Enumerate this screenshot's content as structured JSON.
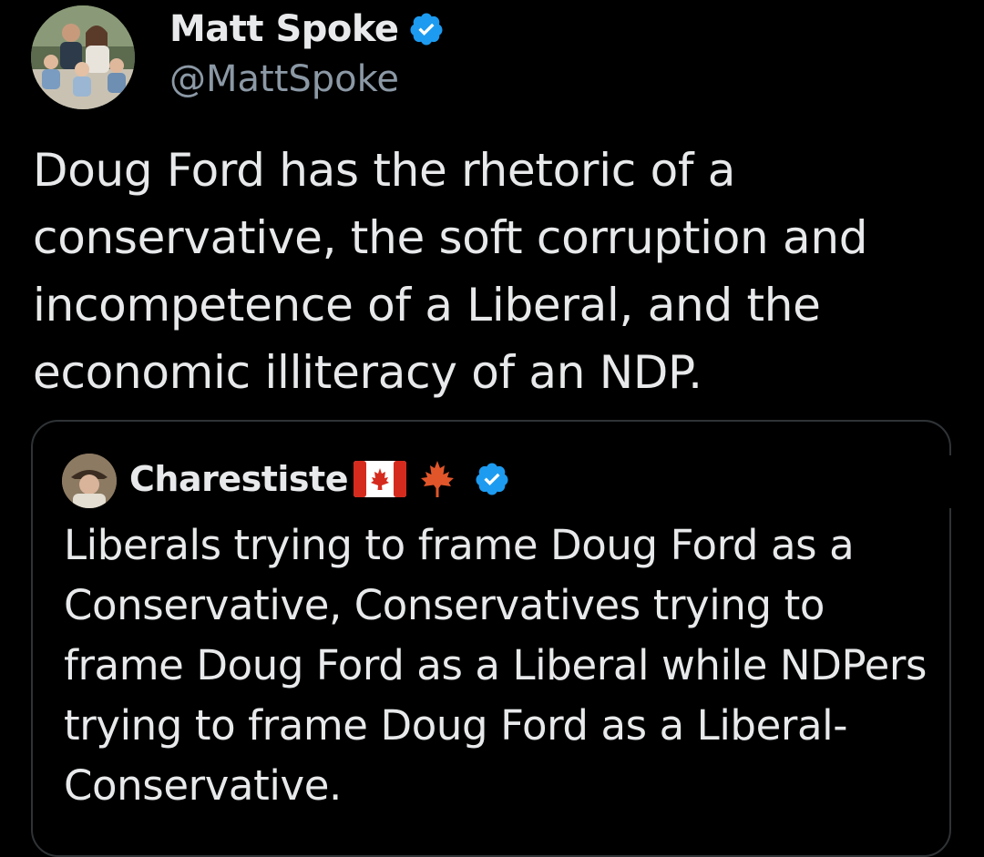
{
  "tweet": {
    "author_name": "Matt Spoke",
    "author_handle": "@MattSpoke",
    "text": "Doug Ford has the rhetoric of a conservative, the soft corruption and incompetence of a Liberal, and the economic illiteracy of an NDP.",
    "avatar_icon": "family-photo-avatar",
    "verified_icon": "verified-badge-icon"
  },
  "quoted_tweet": {
    "author_name": "Charestiste",
    "flag_icon": "canada-flag-icon",
    "leaf_icon": "maple-leaf-icon",
    "verified_icon": "verified-badge-icon",
    "text": "Liberals trying to frame Doug Ford as a Conservative, Conservatives trying to frame Doug Ford as a Liberal while NDPers trying to frame Doug Ford as a Liberal-Conservative."
  },
  "colors": {
    "background": "#000000",
    "text_primary": "#e7e9ea",
    "text_secondary": "#8b98a5",
    "verified_blue": "#1d9bf0",
    "canada_red": "#d52b1e",
    "quote_border": "#2f3336"
  }
}
